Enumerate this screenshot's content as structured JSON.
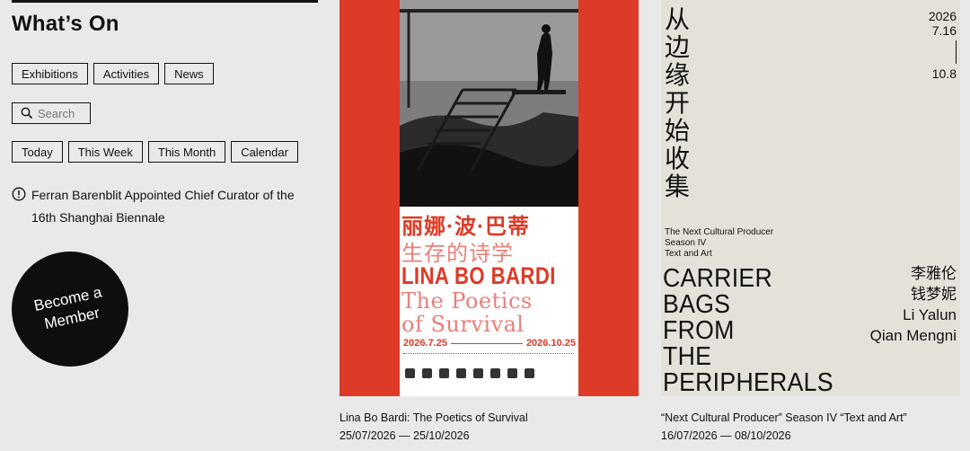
{
  "sidebar": {
    "title": "What’s On",
    "categories": [
      "Exhibitions",
      "Activities",
      "News"
    ],
    "search": {
      "placeholder": "Search"
    },
    "periods": [
      "Today",
      "This Week",
      "This Month",
      "Calendar"
    ],
    "notice": "Ferran Barenblit Appointed Chief Curator of the 16th Shanghai Biennale",
    "member_label_line1": "Become a",
    "member_label_line2": "Member"
  },
  "cards": [
    {
      "title": "Lina Bo Bardi: The Poetics of Survival",
      "dates": "25/07/2026 — 25/10/2026",
      "poster": {
        "cn_line1": "丽娜·波·巴蒂",
        "cn_line2": "生存的诗学",
        "en_line1": "LINA BO BARDI",
        "en_line2": "The Poetics\nof Survival",
        "start": "2026.7.25",
        "end": "2026.10.25"
      }
    },
    {
      "title": "“Next Cultural Producer” Season IV “Text and Art”",
      "dates": "16/07/2026 — 08/10/2026",
      "poster": {
        "cn_vertical": "从边缘开始收集",
        "year": "2026",
        "start": "7.16",
        "end": "10.8",
        "sub1": "The Next Cultural Producer",
        "sub2": "Season IV",
        "sub3": "Text and Art",
        "en_big": "CARRIER\nBAGS\nFROM\nTHE\nPERIPHERALS",
        "name_cn1": "李雅伦",
        "name_cn2": "钱梦妮",
        "name_en1": "Li Yalun",
        "name_en2": "Qian Mengni"
      }
    }
  ],
  "colors": {
    "background": "#e9e9e9",
    "poster1_red": "#dd3a27",
    "poster2_bg": "#e4e2d8",
    "member_circle": "#0e0e0e"
  }
}
